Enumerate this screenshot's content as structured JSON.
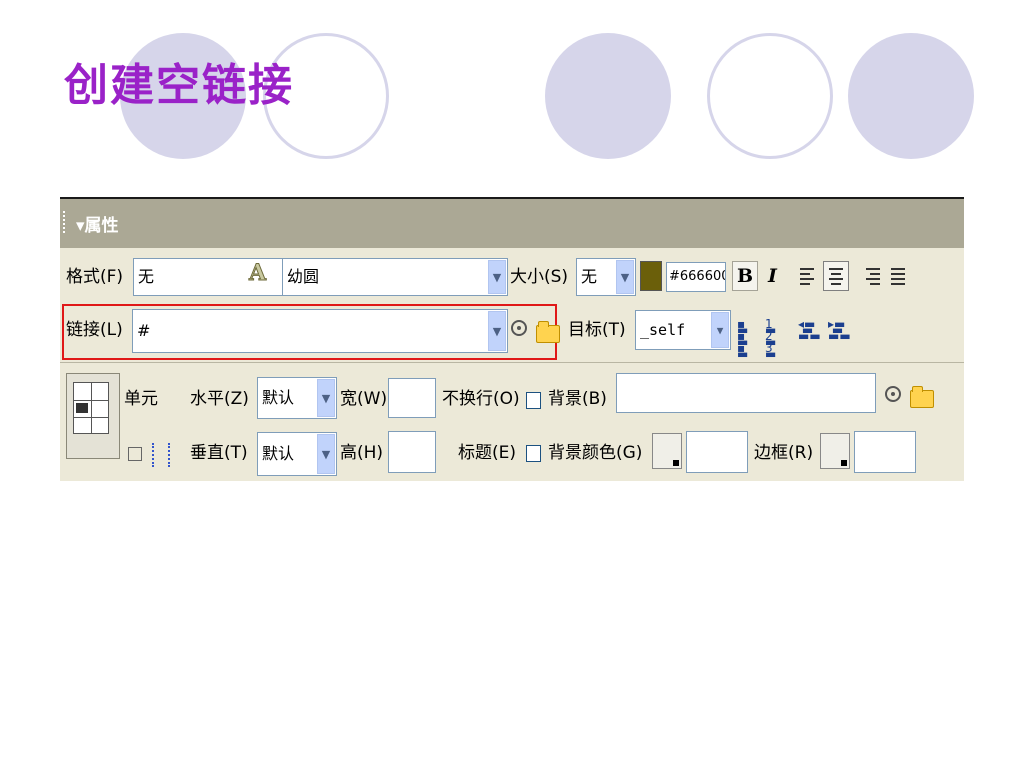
{
  "slide": {
    "title": "创建空链接"
  },
  "panel": {
    "header_title": "▾属性",
    "row1": {
      "format_label": "格式(F)",
      "format_value": "无",
      "font_value": "幼圆",
      "size_label": "大小(S)",
      "size_value": "无",
      "color_value": "#666600",
      "bold_label": "B",
      "italic_label": "I"
    },
    "row2": {
      "link_label": "链接(L)",
      "link_value": "#",
      "target_label": "目标(T)",
      "target_value": "_self"
    },
    "cell": {
      "unit_label": "单元",
      "horz_label": "水平(Z)",
      "horz_value": "默认",
      "width_label": "宽(W)",
      "nowrap_label": "不换行(O)",
      "bg_label": "背景(B)",
      "vert_label": "垂直(T)",
      "vert_value": "默认",
      "height_label": "高(H)",
      "header_label": "标题(E)",
      "bgcolor_label": "背景颜色(G)",
      "border_label": "边框(R)"
    }
  },
  "icons": {
    "font_color_icon": "A",
    "colors": {
      "accent": "#9a22c8",
      "panel_bg": "#ece9d8",
      "header_bg": "#aba895",
      "highlight": "#e01818"
    }
  }
}
